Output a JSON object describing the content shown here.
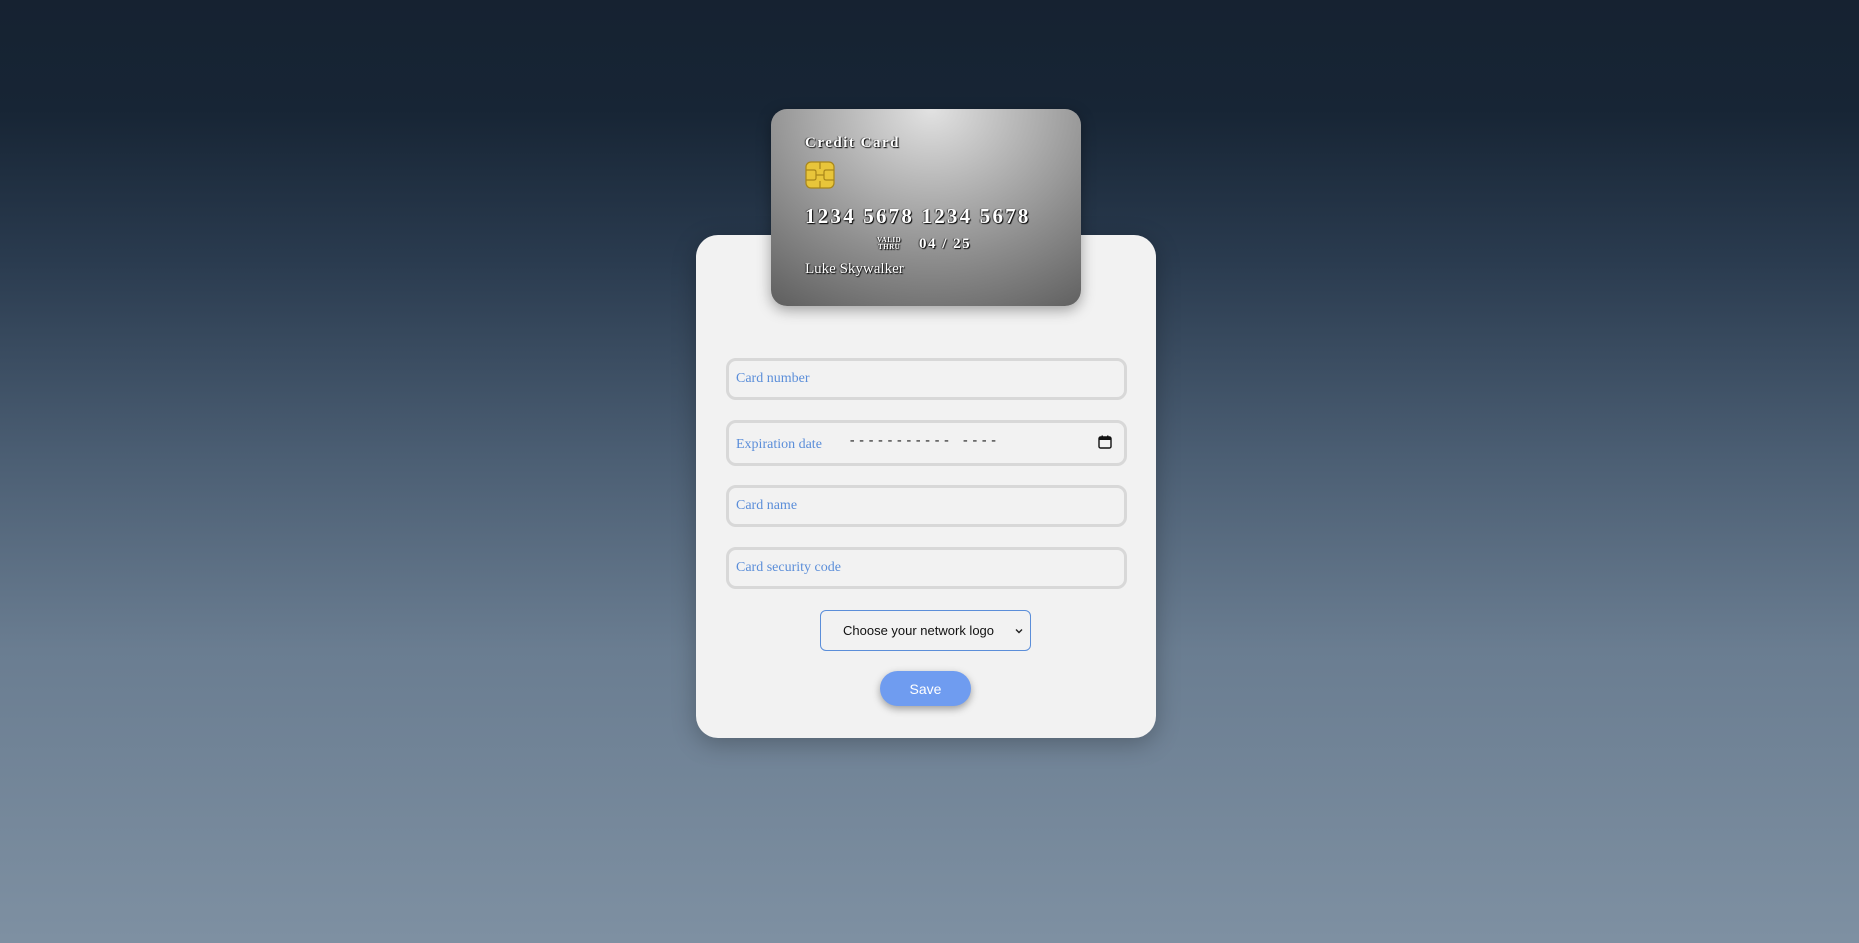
{
  "card": {
    "title": "Credit Card",
    "number": "1234 5678 1234 5678",
    "valid_label_line1": "VALID",
    "valid_label_line2": "THRU",
    "expiry": "04 / 25",
    "holder": "Luke Skywalker"
  },
  "form": {
    "card_number_placeholder": "Card number",
    "expiration_label": "Expiration date",
    "expiration_value": "----------- ----",
    "card_name_placeholder": "Card name",
    "security_code_placeholder": "Card security code",
    "network_select_value": "Choose your network logo",
    "save_label": "Save"
  },
  "colors": {
    "accent": "#6f9cf0",
    "label": "#5b8ed9",
    "panel": "#f2f2f2"
  },
  "icons": {
    "chip": "chip-icon",
    "calendar": "calendar-icon",
    "dropdown": "chevron-down-icon"
  }
}
